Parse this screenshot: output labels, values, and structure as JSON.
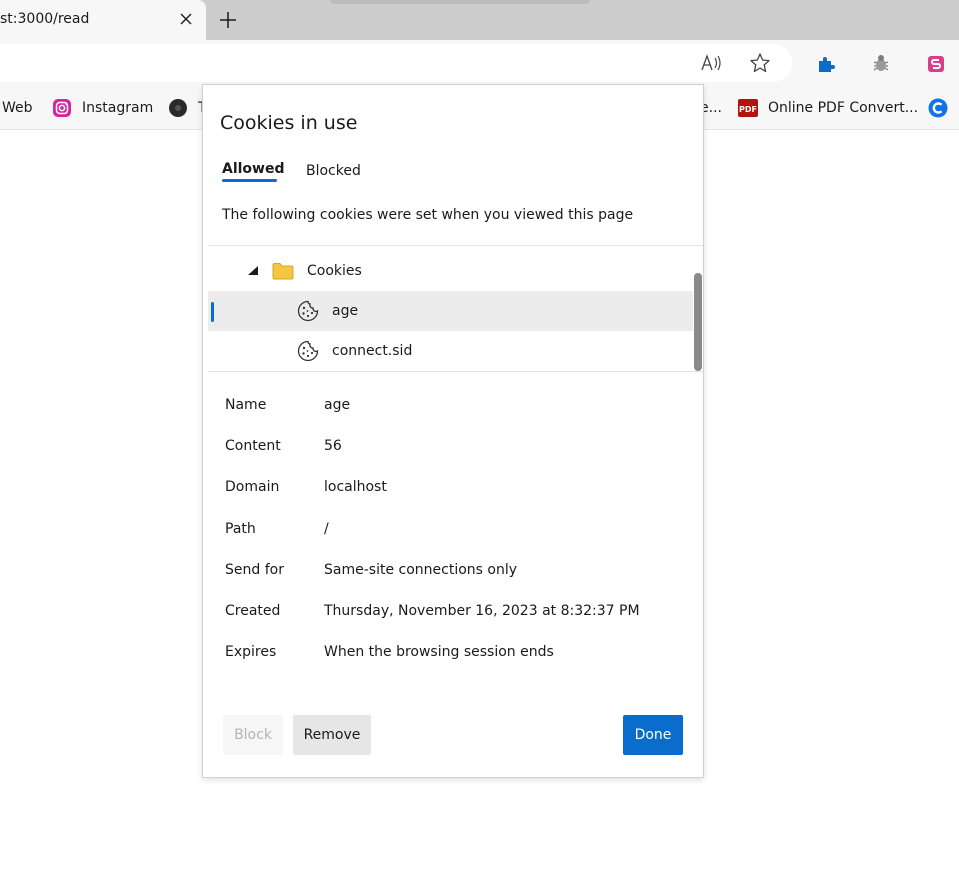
{
  "tab": {
    "title": "st:3000/read"
  },
  "bookmarks": [
    {
      "label": "Web"
    },
    {
      "label": "Instagram"
    },
    {
      "label": "T"
    },
    {
      "label": "e..."
    },
    {
      "label": "Online PDF Convert..."
    }
  ],
  "popup": {
    "title": "Cookies in use",
    "tabs": {
      "allowed": "Allowed",
      "blocked": "Blocked"
    },
    "description": "The following cookies were set when you viewed this page",
    "tree": {
      "folder": "Cookies",
      "items": [
        {
          "label": "age",
          "selected": true
        },
        {
          "label": "connect.sid"
        }
      ]
    },
    "details": [
      {
        "key": "Name",
        "value": "age"
      },
      {
        "key": "Content",
        "value": "56"
      },
      {
        "key": "Domain",
        "value": "localhost"
      },
      {
        "key": "Path",
        "value": "/"
      },
      {
        "key": "Send for",
        "value": "Same-site connections only"
      },
      {
        "key": "Created",
        "value": "Thursday, November 16, 2023 at 8:32:37 PM"
      },
      {
        "key": "Expires",
        "value": "When the browsing session ends"
      }
    ],
    "buttons": {
      "block": "Block",
      "remove": "Remove",
      "done": "Done"
    }
  },
  "colors": {
    "accent": "#0a6ccd",
    "folder": "#f5c640",
    "extension": "#0a6ccd"
  },
  "icons": {
    "tab_close": "close-icon",
    "new_tab": "plus-icon",
    "read_aloud": "read-aloud-icon",
    "favorite": "star-icon",
    "extensions": "puzzle-icon",
    "bug_extension": "bug-icon",
    "extension_s": "s-logo-icon",
    "instagram": "instagram-icon",
    "pdf": "pdf-icon",
    "c_logo": "c-logo-icon",
    "collapse": "triangle-down-icon",
    "folder": "folder-icon",
    "cookie": "cookie-icon"
  }
}
